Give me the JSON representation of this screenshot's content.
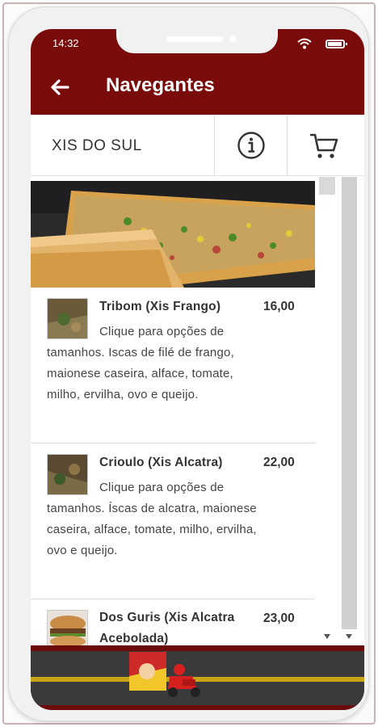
{
  "status": {
    "time": "14:32"
  },
  "appbar": {
    "title": "Navegantes"
  },
  "store": {
    "name": "XIS DO SUL"
  },
  "menu": {
    "items": [
      {
        "name": "Tribom (Xis Frango)",
        "price": "16,00",
        "description": "Clique para opções de tamanhos. Iscas de filé de frango, maionese caseira, alface, tomate, milho, ervilha, ovo e queijo."
      },
      {
        "name": "Crioulo (Xis Alcatra)",
        "price": "22,00",
        "description": "Clique para opções de tamanhos. Íscas de alcatra, maionese caseira, alface, tomate, milho, ervilha, ovo e queijo."
      },
      {
        "name": "Dos Guris (Xis Alcatra Acebolada)",
        "price": "23,00",
        "description": ""
      }
    ]
  },
  "icons": {
    "back": "arrow-left-icon",
    "info": "info-icon",
    "cart": "cart-icon",
    "wifi": "wifi-icon",
    "battery": "battery-icon"
  },
  "colors": {
    "brand": "#7a0b0b",
    "text": "#333333"
  }
}
